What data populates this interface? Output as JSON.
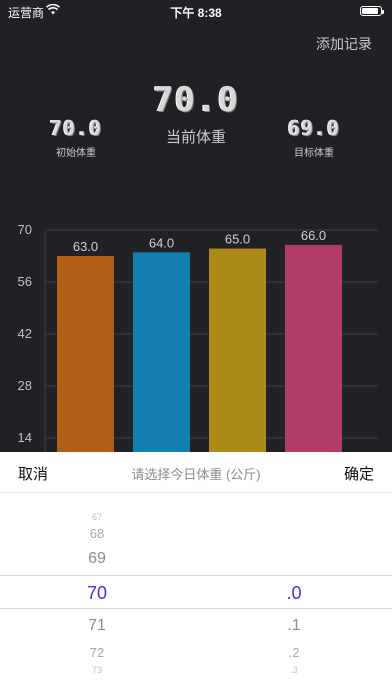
{
  "status_bar": {
    "carrier": "运营商",
    "time": "下午 8:38",
    "battery_level": 0.9
  },
  "header": {
    "add_record_label": "添加记录"
  },
  "weights": {
    "current_value": "70.0",
    "current_label": "当前体重",
    "initial_value": "70.0",
    "initial_label": "初始体重",
    "target_value": "69.0",
    "target_label": "目标体重"
  },
  "chart_data": {
    "type": "bar",
    "categories": [
      "",
      "",
      "",
      ""
    ],
    "values": [
      63.0,
      64.0,
      65.0,
      66.0
    ],
    "data_labels": [
      "63.0",
      "64.0",
      "65.0",
      "66.0"
    ],
    "y_ticks": [
      "14",
      "28",
      "42",
      "56",
      "70"
    ],
    "ylim": [
      0,
      70
    ],
    "grid": true,
    "colors": [
      "#b25f15",
      "#137fb0",
      "#ac8b19",
      "#b23c67"
    ]
  },
  "picker": {
    "cancel_label": "取消",
    "title": "请选择今日体重 (公斤)",
    "confirm_label": "确定",
    "integer_options": [
      "67",
      "68",
      "69",
      "70",
      "71",
      "72",
      "73"
    ],
    "decimal_options": [
      ".0",
      ".1",
      ".2",
      ".3"
    ],
    "selected_integer": "70",
    "selected_decimal": ".0",
    "selected_color": "#3b37d8"
  }
}
